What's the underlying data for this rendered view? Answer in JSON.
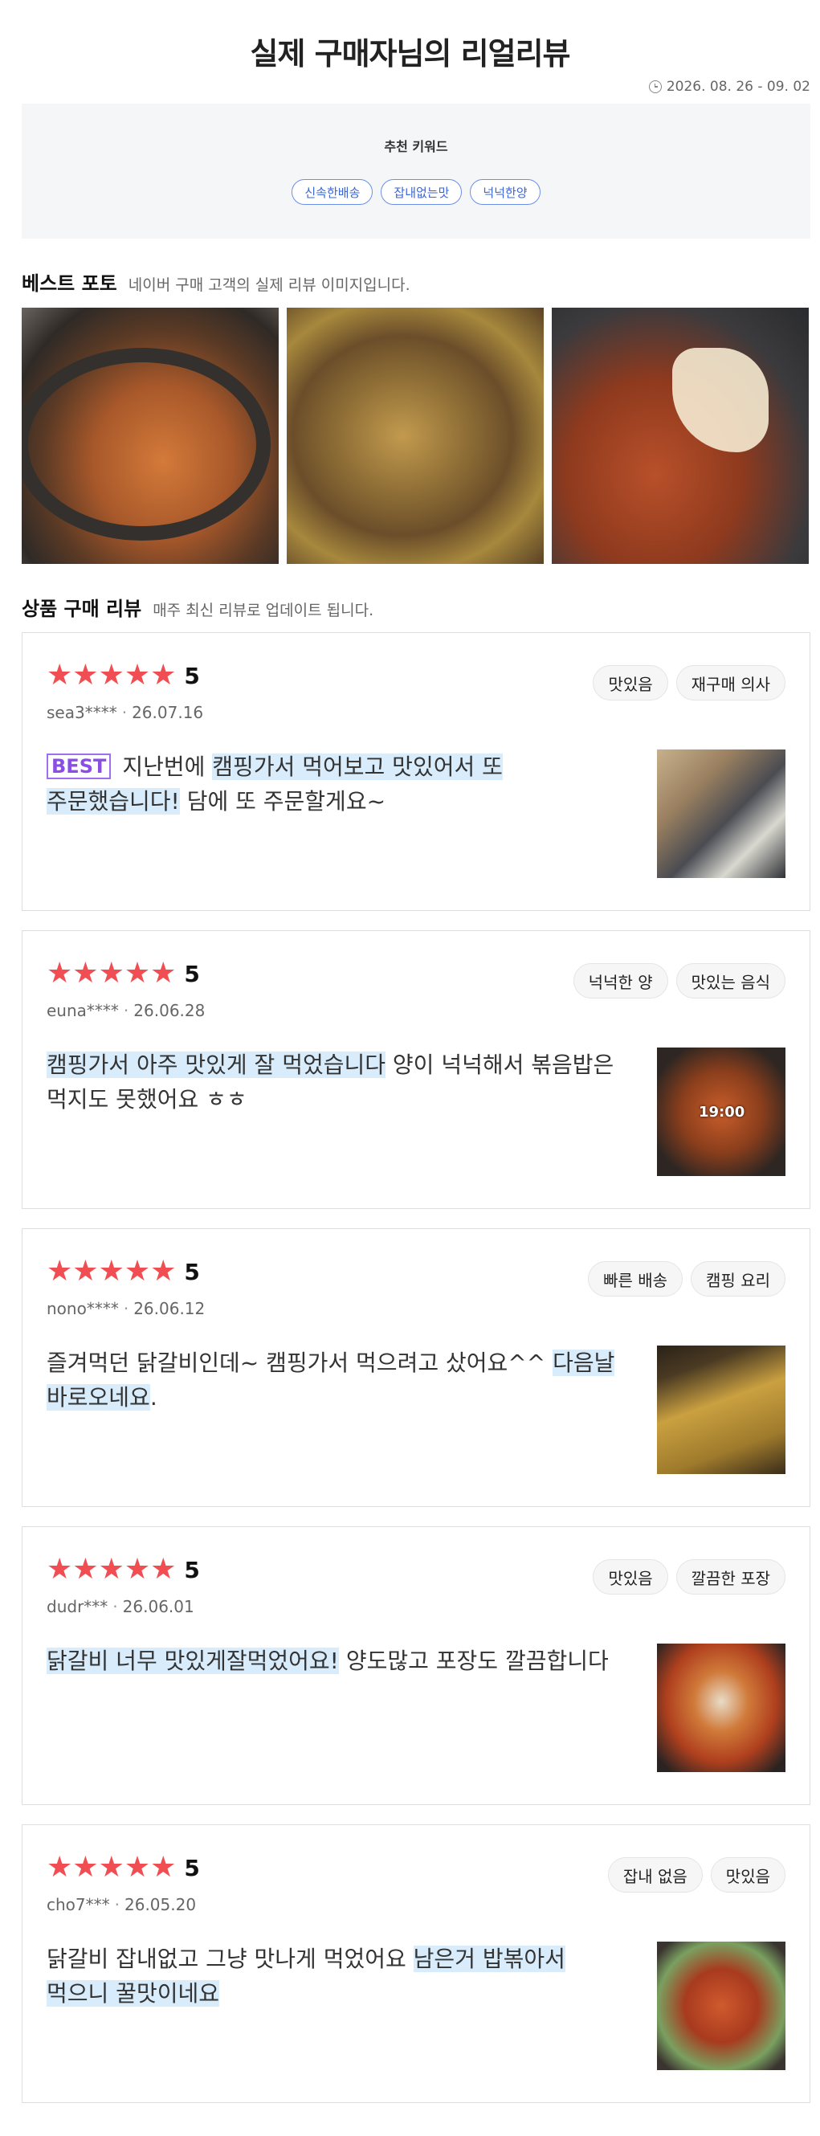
{
  "header": {
    "title": "실제 구매자님의 리얼리뷰",
    "period": "2026. 08. 26 - 09. 02"
  },
  "keywords": {
    "title": "추천 키워드",
    "items": [
      "신속한배송",
      "잡내없는맛",
      "넉넉한양"
    ]
  },
  "best_photo": {
    "heading": "베스트 포토",
    "subtitle": "네이버 구매 고객의 실제 리뷰 이미지입니다."
  },
  "reviews_section": {
    "heading": "상품 구매 리뷰",
    "subtitle": "매주 최신 리뷰로 업데이트 됩니다."
  },
  "reviews": [
    {
      "score": "5",
      "user": "sea3****",
      "date": "26.07.16",
      "tags": [
        "맛있음",
        "재구매 의사"
      ],
      "best": "BEST",
      "text_a": "지난번에 ",
      "text_hl": "캠핑가서 먹어보고 맛있어서 또 주문했습니다!",
      "text_b": " 담에 또 주문할게요~",
      "thumb_icon": "meal-kit-box-photo"
    },
    {
      "score": "5",
      "user": "euna****",
      "date": "26.06.28",
      "tags": [
        "넉넉한 양",
        "맛있는 음식"
      ],
      "text_a": "",
      "text_hl": "캠핑가서 아주 맛있게 잘 먹었습니다",
      "text_b": " 양이 넉넉해서 볶음밥은 먹지도 못했어요 ㅎㅎ",
      "thumb_overlay": "19:00",
      "thumb_icon": "dakgalbi-video-photo"
    },
    {
      "score": "5",
      "user": "nono****",
      "date": "26.06.12",
      "tags": [
        "빠른 배송",
        "캠핑 요리"
      ],
      "text_a": "즐겨먹던 닭갈비인데~ 캠핑가서 먹으려고 샀어요^^ ",
      "text_hl": "다음날 바로오네요",
      "text_b": ".",
      "thumb_icon": "package-pouch-photo"
    },
    {
      "score": "5",
      "user": "dudr***",
      "date": "26.06.01",
      "tags": [
        "맛있음",
        "깔끔한 포장"
      ],
      "text_a": "",
      "text_hl": "닭갈비 너무 맛있게잘먹었어요!",
      "text_b": " 양도많고 포장도 깔끔합니다",
      "thumb_icon": "cheese-dakgalbi-photo"
    },
    {
      "score": "5",
      "user": "cho7***",
      "date": "26.05.20",
      "tags": [
        "잡내 없음",
        "맛있음"
      ],
      "text_a": "닭갈비 잡내없고 그냥 맛나게 먹었어요 ",
      "text_hl": "남은거 밥볶아서 먹으니 꿀맛이네요",
      "text_b": "",
      "thumb_icon": "dakgalbi-pan-photo"
    }
  ],
  "colors": {
    "star": "#f04e52",
    "highlight": "#d8ecfb",
    "best_badge": "#8a4ee8",
    "keyword_chip": "#3a66d8"
  }
}
